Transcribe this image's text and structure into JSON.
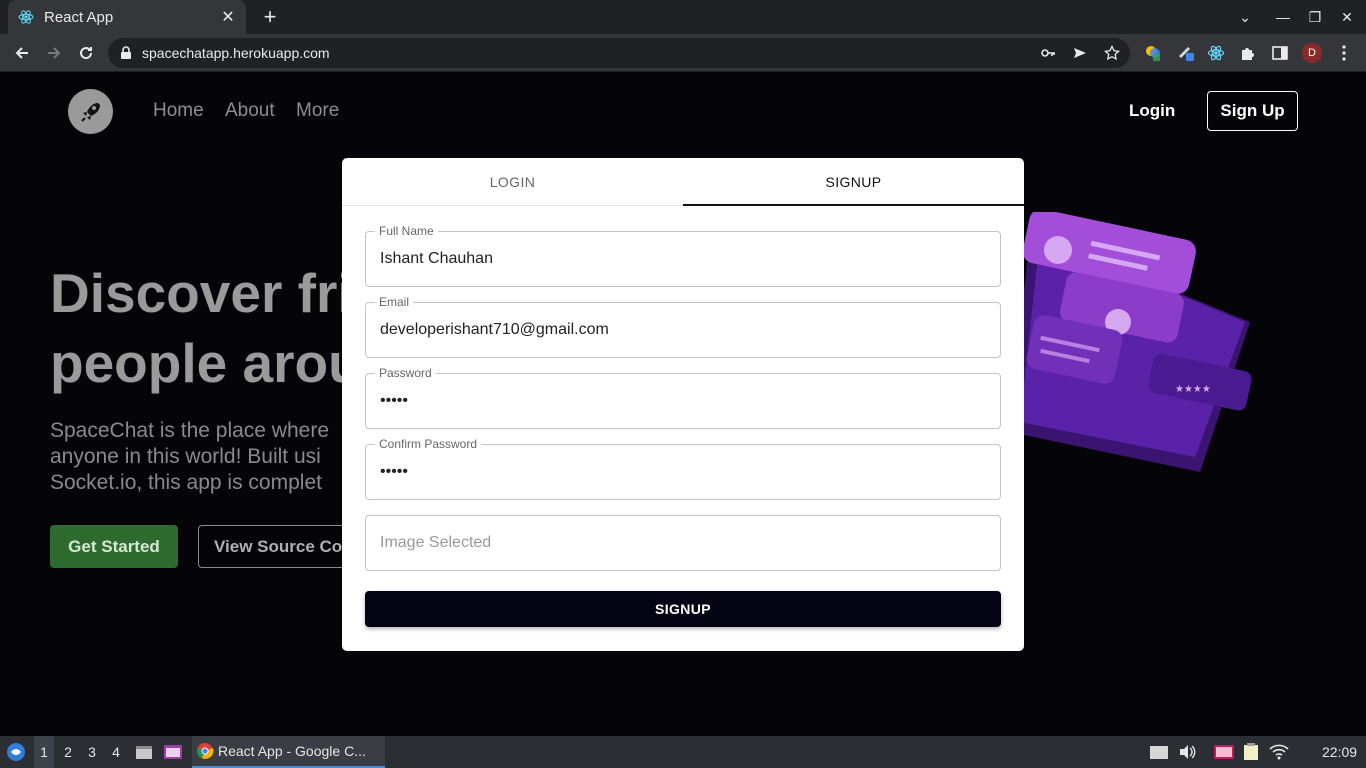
{
  "browser": {
    "tab_title": "React App",
    "url": "spacechatapp.herokuapp.com",
    "profile_initial": "D"
  },
  "nav": {
    "links": [
      "Home",
      "About",
      "More"
    ],
    "login": "Login",
    "signup": "Sign Up"
  },
  "hero": {
    "title_line1": "Discover fri",
    "title_line2": "people arou",
    "desc_line1": "SpaceChat is the place where",
    "desc_line2": "anyone in this world! Built usi",
    "desc_line3": "Socket.io, this app is complet",
    "get_started": "Get Started",
    "view_source": "View Source Co"
  },
  "modal": {
    "tabs": [
      "LOGIN",
      "SIGNUP"
    ],
    "active_tab": "SIGNUP",
    "fields": {
      "full_name": {
        "label": "Full Name",
        "value": "Ishant Chauhan"
      },
      "email": {
        "label": "Email",
        "value": "developerishant710@gmail.com"
      },
      "password": {
        "label": "Password",
        "value": "•••••"
      },
      "confirm_password": {
        "label": "Confirm Password",
        "value": "•••••"
      },
      "image": {
        "placeholder": "Image Selected"
      }
    },
    "submit": "SIGNUP"
  },
  "taskbar": {
    "workspaces": [
      "1",
      "2",
      "3",
      "4"
    ],
    "active_window": "React App - Google C...",
    "clock": "22:09"
  },
  "colors": {
    "page_bg": "#050509",
    "accent_green": "#2e6b2f",
    "submit_bg": "#040414",
    "phone_purple": "#7b2fbf"
  }
}
